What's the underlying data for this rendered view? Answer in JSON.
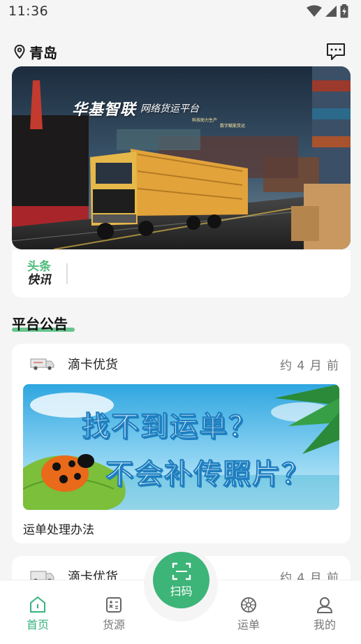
{
  "status": {
    "time": "11:36"
  },
  "header": {
    "city": "青岛"
  },
  "banner": {
    "title": "华基智联",
    "subtitle": "网络货运平台",
    "tag1": "科技助力生产",
    "tag2": "数字赋能货运"
  },
  "news": {
    "tag_top": "头条",
    "tag_bottom": "快讯"
  },
  "section": {
    "title": "平台公告"
  },
  "announcements": [
    {
      "source": "滴卡优货",
      "time": "约 4 月 前",
      "image_line1": "找不到运单？",
      "image_line2": "不会补传照片？",
      "caption": "运单处理办法"
    },
    {
      "source": "滴卡优货",
      "time": "约 4 月 前"
    }
  ],
  "tabs": {
    "home": "首页",
    "goods": "货源",
    "scan": "扫码",
    "orders": "运单",
    "mine": "我的"
  },
  "colors": {
    "accent": "#3db478",
    "active_tab": "#35b37e"
  }
}
